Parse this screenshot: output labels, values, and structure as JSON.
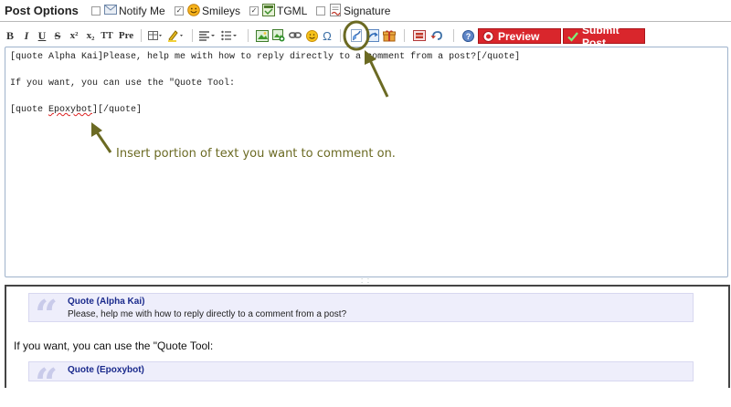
{
  "options": {
    "title": "Post Options",
    "notify": {
      "label": "Notify Me",
      "checked": false,
      "icon": "envelope-icon"
    },
    "smileys": {
      "label": "Smileys",
      "checked": true,
      "icon": "smiley-icon"
    },
    "tgml": {
      "label": "TGML",
      "checked": true,
      "icon": "tgml-icon"
    },
    "signature": {
      "label": "Signature",
      "checked": false,
      "icon": "signature-icon"
    }
  },
  "toolbar": {
    "bold": "B",
    "italic": "I",
    "underline": "U",
    "strike": "S",
    "superscript": "x²",
    "subscript": "x₂",
    "teletype": "TT",
    "pre": "Pre",
    "preview_label": "Preview",
    "submit_label": "Submit Post"
  },
  "editor": {
    "lines": [
      "[quote Alpha Kai]Please, help me with how to reply directly to a comment from a post?[/quote]",
      "If you want, you can use the \"Quote Tool:",
      "[quote ",
      "Epoxybot",
      "][/quote]"
    ],
    "annotation": "Insert portion of text you want to comment on."
  },
  "preview": {
    "quote1": {
      "header": "Quote (Alpha Kai)",
      "body": "Please, help me with how to reply directly to a comment from a post?"
    },
    "text": "If you want, you can use the \"Quote Tool:",
    "quote2": {
      "header": "Quote (Epoxybot)"
    }
  },
  "colors": {
    "accent_red": "#d9262c",
    "annotation_olive": "#6b6a23",
    "quote_link_blue": "#1a2a8c"
  }
}
